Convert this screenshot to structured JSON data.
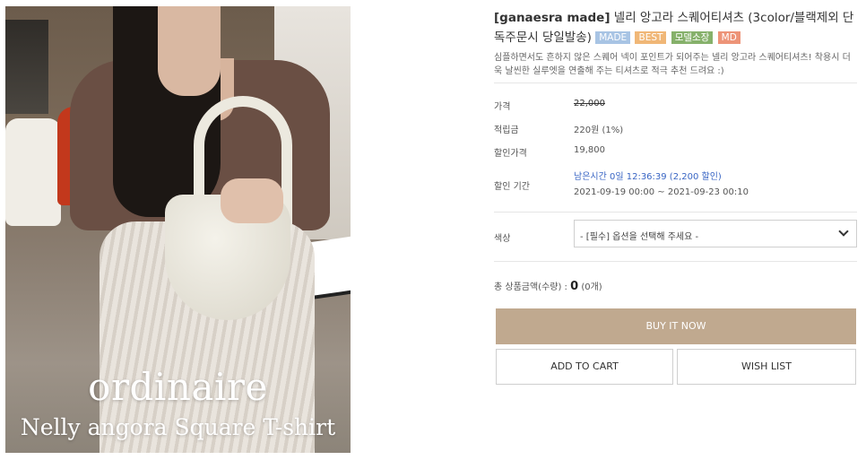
{
  "image": {
    "overlay_title": "ordinaire",
    "overlay_subtitle": "Nelly angora Square T-shirt"
  },
  "product": {
    "brand": "[ganaesra made]",
    "name": "넬리 앙고라 스퀘어티셔츠 (3color/블랙제외 단독주문시 당일발송)",
    "badges": [
      {
        "label": "MADE",
        "color": "#a8c4e4"
      },
      {
        "label": "BEST",
        "color": "#f0b777"
      },
      {
        "label": "모델소장",
        "color": "#86b16b"
      },
      {
        "label": "MD",
        "color": "#ed9478"
      }
    ],
    "description": "심플하면서도 흔하지 않은 스퀘어 넥이 포인트가 되어주는 넬리 앙고라 스퀘어티셔츠! 착용시 더욱 날씬한 실루엣을 연출해 주는 티셔츠로 적극 추천 드려요 :)"
  },
  "details": {
    "price_label": "가격",
    "price_value": "22,000",
    "points_label": "적립금",
    "points_value": "220원 (1%)",
    "sale_price_label": "할인가격",
    "sale_price_value": "19,800",
    "sale_period_label": "할인 기간",
    "remaining_time": "남은시간 0일 12:36:39 (2,200 할인)",
    "period_range": "2021-09-19 00:00 ~ 2021-09-23 00:10"
  },
  "options": {
    "color_label": "색상",
    "color_placeholder": "- [필수] 옵션을 선택해 주세요 -"
  },
  "total": {
    "label": "총 상품금액(수량) : ",
    "amount": "0",
    "quantity": "(0개)"
  },
  "buttons": {
    "buy_now": "BUY IT NOW",
    "add_to_cart": "ADD TO CART",
    "wish_list": "WISH LIST"
  },
  "colors": {
    "accent": "#c0a98f",
    "link_blue": "#3a66c4"
  }
}
